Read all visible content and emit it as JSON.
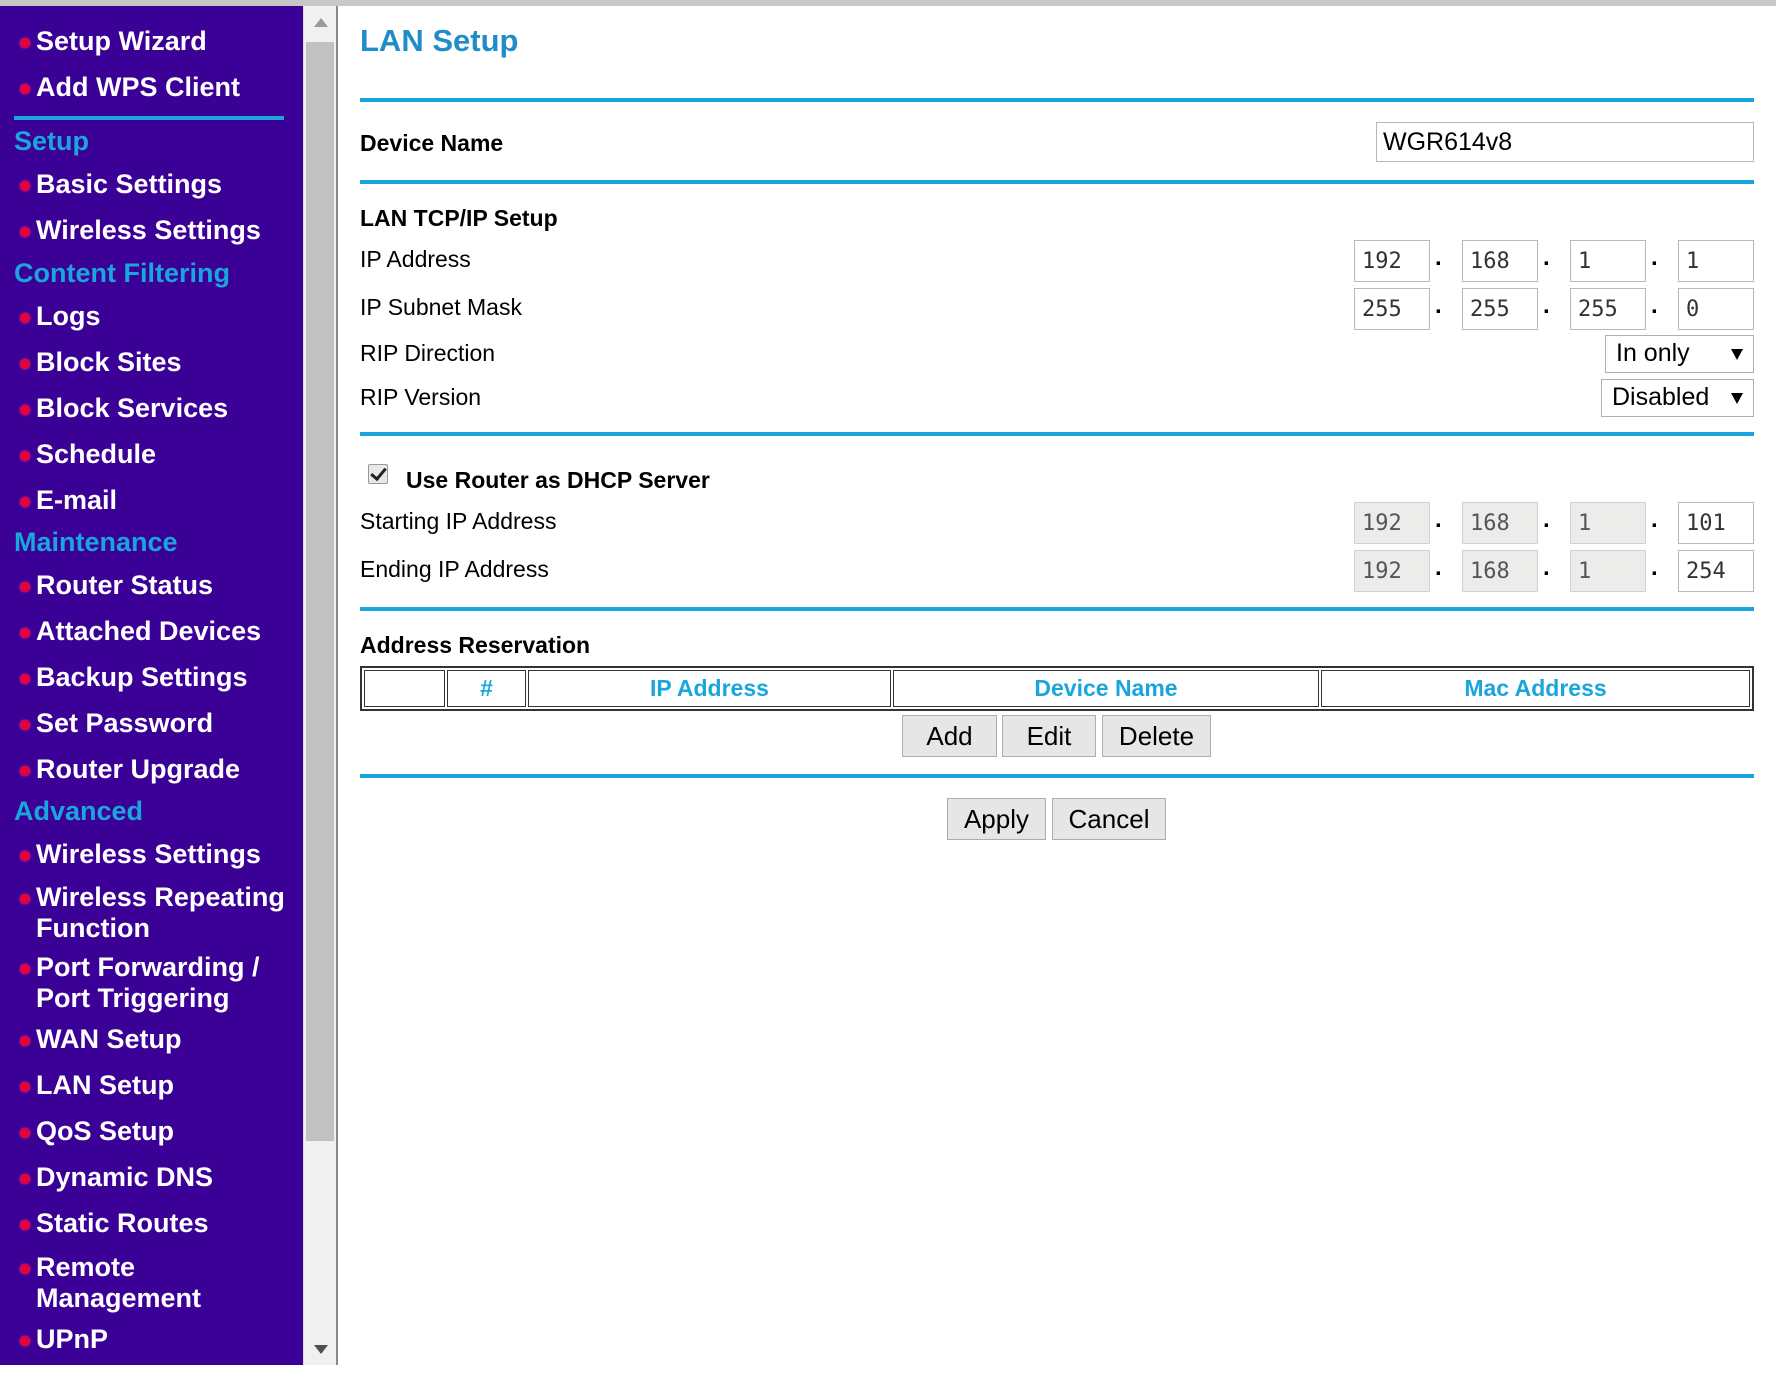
{
  "nav": {
    "wizard_items": [
      {
        "label": "Setup Wizard"
      },
      {
        "label": "Add WPS Client"
      }
    ],
    "sections": [
      {
        "title": "Setup",
        "items": [
          {
            "label": "Basic Settings"
          },
          {
            "label": "Wireless Settings"
          }
        ]
      },
      {
        "title": "Content Filtering",
        "items": [
          {
            "label": "Logs"
          },
          {
            "label": "Block Sites"
          },
          {
            "label": "Block Services"
          },
          {
            "label": "Schedule"
          },
          {
            "label": "E-mail"
          }
        ]
      },
      {
        "title": "Maintenance",
        "items": [
          {
            "label": "Router Status"
          },
          {
            "label": "Attached Devices"
          },
          {
            "label": "Backup Settings"
          },
          {
            "label": "Set Password"
          },
          {
            "label": "Router Upgrade"
          }
        ]
      },
      {
        "title": "Advanced",
        "items": [
          {
            "label": "Wireless Settings"
          },
          {
            "label": "Wireless Repeating",
            "label2": "Function"
          },
          {
            "label": "Port Forwarding /",
            "label2": "Port Triggering"
          },
          {
            "label": "WAN Setup"
          },
          {
            "label": "LAN Setup"
          },
          {
            "label": "QoS Setup"
          },
          {
            "label": "Dynamic DNS"
          },
          {
            "label": "Static Routes"
          },
          {
            "label": "Remote",
            "label2": "Management"
          },
          {
            "label": "UPnP"
          }
        ]
      }
    ]
  },
  "page": {
    "title": "LAN Setup"
  },
  "device_name": {
    "label": "Device Name",
    "value": "WGR614v8"
  },
  "lan_tcpip": {
    "heading": "LAN TCP/IP Setup",
    "ip_label": "IP Address",
    "ip": [
      "192",
      "168",
      "1",
      "1"
    ],
    "mask_label": "IP Subnet Mask",
    "mask": [
      "255",
      "255",
      "255",
      "0"
    ],
    "rip_direction_label": "RIP Direction",
    "rip_direction_value": "In only",
    "rip_version_label": "RIP Version",
    "rip_version_value": "Disabled"
  },
  "dhcp": {
    "checkbox_label": "Use Router as DHCP Server",
    "checked": true,
    "start_label": "Starting IP Address",
    "start": [
      "192",
      "168",
      "1",
      "101"
    ],
    "end_label": "Ending IP Address",
    "end": [
      "192",
      "168",
      "1",
      "254"
    ]
  },
  "reservation": {
    "heading": "Address Reservation",
    "columns": [
      "",
      "#",
      "IP Address",
      "Device Name",
      "Mac Address"
    ],
    "add_label": "Add",
    "edit_label": "Edit",
    "delete_label": "Delete"
  },
  "actions": {
    "apply_label": "Apply",
    "cancel_label": "Cancel"
  },
  "colors": {
    "nav_bg": "#3b0096",
    "accent": "#1aa6dc",
    "bullet": "#e8003c",
    "title": "#1f8ec8"
  }
}
